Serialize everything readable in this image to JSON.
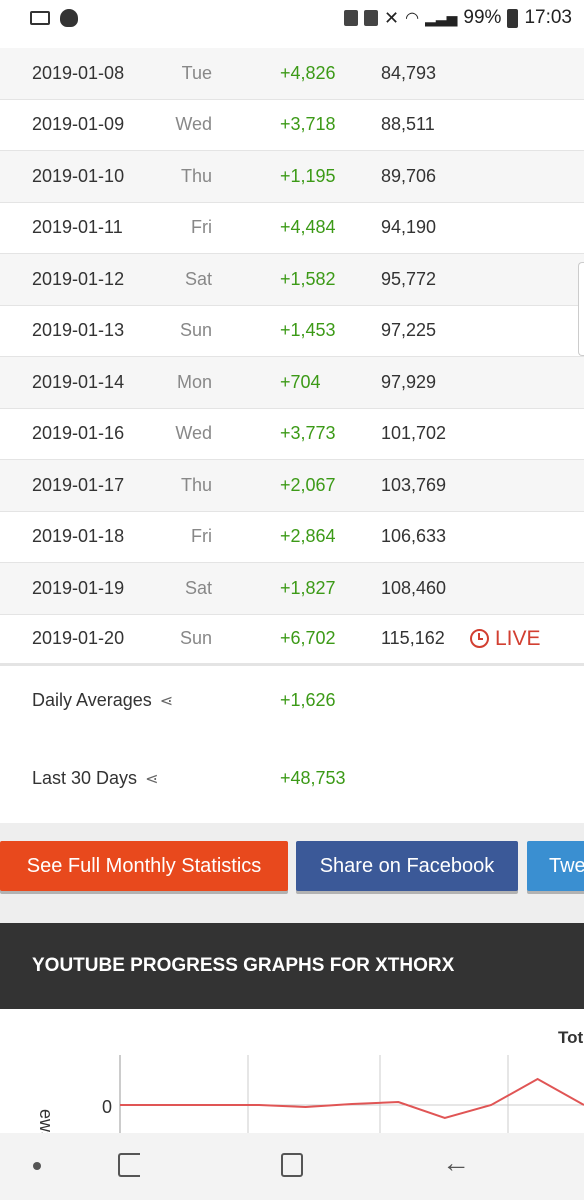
{
  "status_bar": {
    "battery": "99%",
    "time": "17:03"
  },
  "rows": [
    {
      "date": "2019-01-08",
      "day": "Tue",
      "delta": "+4,826",
      "total": "84,793"
    },
    {
      "date": "2019-01-09",
      "day": "Wed",
      "delta": "+3,718",
      "total": "88,511"
    },
    {
      "date": "2019-01-10",
      "day": "Thu",
      "delta": "+1,195",
      "total": "89,706"
    },
    {
      "date": "2019-01-11",
      "day": "Fri",
      "delta": "+4,484",
      "total": "94,190"
    },
    {
      "date": "2019-01-12",
      "day": "Sat",
      "delta": "+1,582",
      "total": "95,772"
    },
    {
      "date": "2019-01-13",
      "day": "Sun",
      "delta": "+1,453",
      "total": "97,225"
    },
    {
      "date": "2019-01-14",
      "day": "Mon",
      "delta": "+704",
      "total": "97,929"
    },
    {
      "date": "2019-01-16",
      "day": "Wed",
      "delta": "+3,773",
      "total": "101,702"
    },
    {
      "date": "2019-01-17",
      "day": "Thu",
      "delta": "+2,067",
      "total": "103,769"
    },
    {
      "date": "2019-01-18",
      "day": "Fri",
      "delta": "+2,864",
      "total": "106,633"
    },
    {
      "date": "2019-01-19",
      "day": "Sat",
      "delta": "+1,827",
      "total": "108,460"
    },
    {
      "date": "2019-01-20",
      "day": "Sun",
      "delta": "+6,702",
      "total": "115,162",
      "badge": "LIVE"
    }
  ],
  "summary": {
    "daily_label": "Daily Averages",
    "daily_value": "+1,626",
    "last30_label": "Last 30 Days",
    "last30_value": "+48,753"
  },
  "buttons": {
    "monthly": "See Full Monthly Statistics",
    "facebook": "Share on Facebook",
    "twitter": "Twe"
  },
  "graphs": {
    "heading": "YOUTUBE PROGRESS GRAPHS FOR XTHORX",
    "chart_title_fragment": "Tot",
    "y_label_fragment": "ews",
    "y_tick": "0"
  },
  "colors": {
    "positive": "#3c9a17",
    "live": "#d23f31",
    "monthly_button": "#e8491d",
    "facebook_button": "#3b5998",
    "twitter_button": "#3a8fd1",
    "header_bg": "#333333"
  },
  "chart_data": {
    "type": "line",
    "title": "Tot",
    "ylabel": "ews",
    "y_ticks": [
      "0"
    ],
    "series": [
      {
        "values": [
          0,
          0,
          0,
          0,
          -0.2,
          0.1,
          0.3,
          -1.3,
          0,
          2.6,
          0
        ]
      }
    ]
  }
}
